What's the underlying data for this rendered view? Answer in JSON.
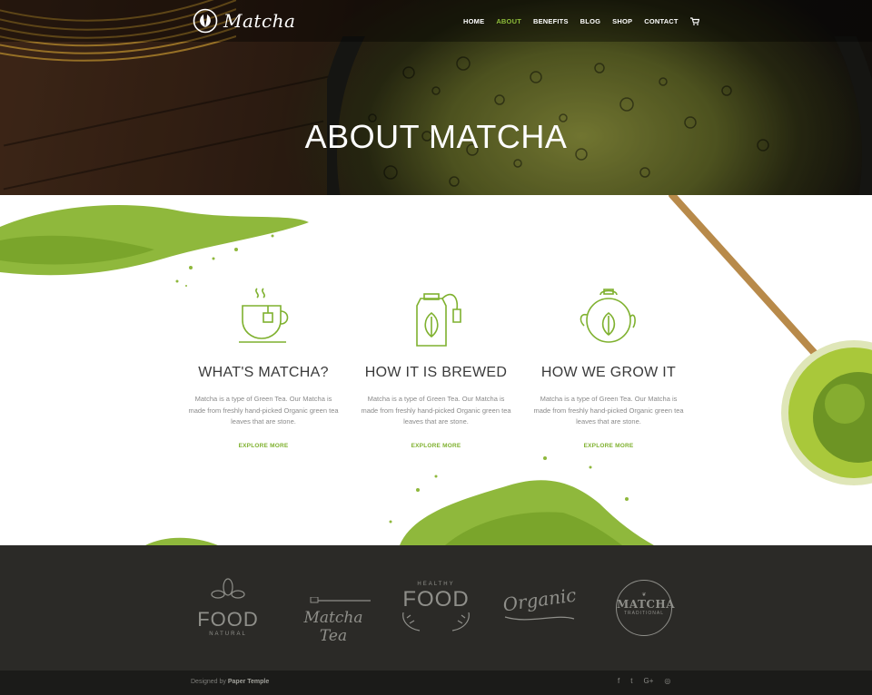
{
  "brand": {
    "logo_text": "Matcha",
    "logo_icon": "leaf-circle-icon"
  },
  "nav": {
    "items": [
      {
        "label": "HOME",
        "active": false
      },
      {
        "label": "ABOUT",
        "active": true
      },
      {
        "label": "BENEFITS",
        "active": false
      },
      {
        "label": "BLOG",
        "active": false
      },
      {
        "label": "SHOP",
        "active": false
      },
      {
        "label": "CONTACT",
        "active": false
      }
    ],
    "cart_icon": "cart-icon"
  },
  "hero": {
    "title": "ABOUT MATCHA"
  },
  "features": [
    {
      "icon": "tea-cup-icon",
      "title": "WHAT'S MATCHA?",
      "text": "Matcha is a type of Green Tea. Our Matcha is made from freshly hand-picked Organic green tea leaves that are stone.",
      "link": "EXPLORE MORE"
    },
    {
      "icon": "tea-bag-icon",
      "title": "HOW IT IS BREWED",
      "text": "Matcha is a type of Green Tea. Our Matcha is made from freshly hand-picked Organic green tea leaves that are stone.",
      "link": "EXPLORE MORE"
    },
    {
      "icon": "teapot-icon",
      "title": "HOW WE GROW IT",
      "text": "Matcha is a type of Green Tea. Our Matcha is made from freshly hand-picked Organic green tea leaves that are stone.",
      "link": "EXPLORE MORE"
    }
  ],
  "partner_logos": {
    "food_natural": {
      "big": "FOOD",
      "small": "NATURAL"
    },
    "matcha_tea": {
      "text": "Matcha Tea"
    },
    "healthy_food": {
      "top": "HEALTHY",
      "big": "FOOD"
    },
    "organic": {
      "text": "Organic"
    },
    "matcha_traditional": {
      "big": "MATCHA",
      "small": "TRADITIONAL"
    }
  },
  "footer": {
    "credit_prefix": "Designed by",
    "credit_name": "Paper Temple",
    "social": [
      {
        "icon": "facebook-icon",
        "glyph": "f"
      },
      {
        "icon": "twitter-icon",
        "glyph": "t"
      },
      {
        "icon": "google-plus-icon",
        "glyph": "G+"
      },
      {
        "icon": "instagram-icon",
        "glyph": "◎"
      }
    ]
  },
  "colors": {
    "accent": "#7fb12f",
    "dark_band": "#2b2a27",
    "footer": "#1b1b19"
  }
}
